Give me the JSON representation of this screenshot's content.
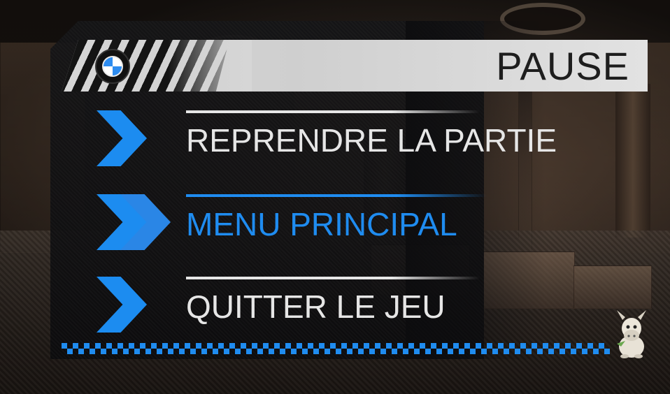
{
  "title": "PAUSE",
  "menu": {
    "items": [
      {
        "label": "REPRENDRE LA PARTIE",
        "selected": false
      },
      {
        "label": "MENU PRINCIPAL",
        "selected": true
      },
      {
        "label": "QUITTER LE JEU",
        "selected": false
      }
    ]
  },
  "colors": {
    "accent": "#1f8cf0",
    "text_default": "#e6e6e6",
    "text_selected": "#1f8cf0",
    "header_bg": "#d6d6d6",
    "header_text": "#1e1e1e"
  },
  "icons": {
    "logo": "roundel-logo-icon",
    "chevron": "chevron-right-icon",
    "double_chevron": "double-chevron-right-icon",
    "mascot": "donkey-mascot-icon"
  }
}
